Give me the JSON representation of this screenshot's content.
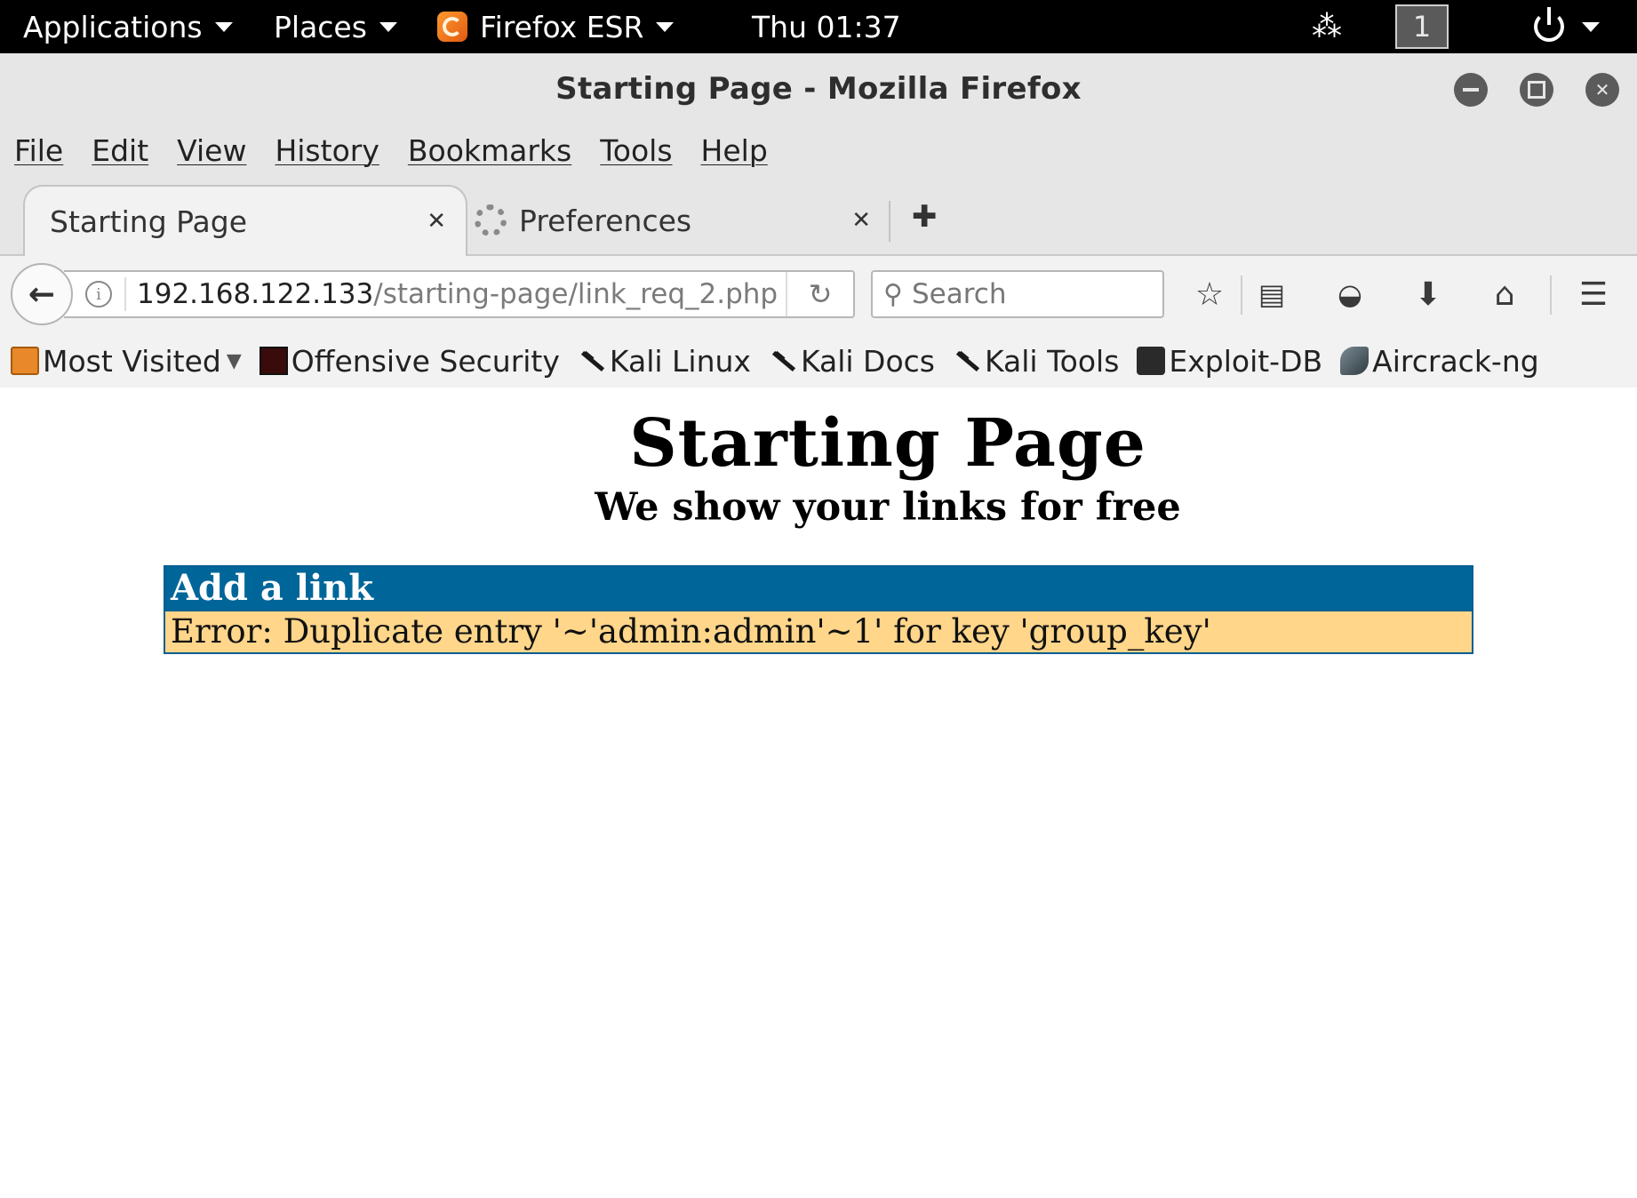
{
  "topbar": {
    "applications": "Applications",
    "places": "Places",
    "app_name": "Firefox ESR",
    "clock": "Thu 01:37",
    "workspace": "1"
  },
  "window": {
    "title": "Starting Page - Mozilla Firefox"
  },
  "menubar": {
    "items": [
      "File",
      "Edit",
      "View",
      "History",
      "Bookmarks",
      "Tools",
      "Help"
    ]
  },
  "tabs": [
    {
      "label": "Starting Page",
      "active": true
    },
    {
      "label": "Preferences",
      "active": false
    }
  ],
  "navbar": {
    "url_host": "192.168.122.133",
    "url_path": "/starting-page/link_req_2.php",
    "search_placeholder": "Search"
  },
  "bookmarks": [
    {
      "label": "Most Visited",
      "icon": "folder-icon"
    },
    {
      "label": "Offensive Security",
      "icon": "offsec-icon"
    },
    {
      "label": "Kali Linux",
      "icon": "kali-icon"
    },
    {
      "label": "Kali Docs",
      "icon": "kali-icon"
    },
    {
      "label": "Kali Tools",
      "icon": "kali-icon"
    },
    {
      "label": "Exploit-DB",
      "icon": "exploitdb-icon"
    },
    {
      "label": "Aircrack-ng",
      "icon": "aircrack-icon"
    }
  ],
  "page": {
    "title": "Starting Page",
    "subtitle": "We show your links for free",
    "panel_header": "Add a link",
    "error_message": "Error: Duplicate entry '~'admin:admin'~1' for key 'group_key'"
  },
  "colors": {
    "panel_header_bg": "#006699",
    "error_bg": "#ffd68a",
    "topbar_bg": "#000000"
  }
}
